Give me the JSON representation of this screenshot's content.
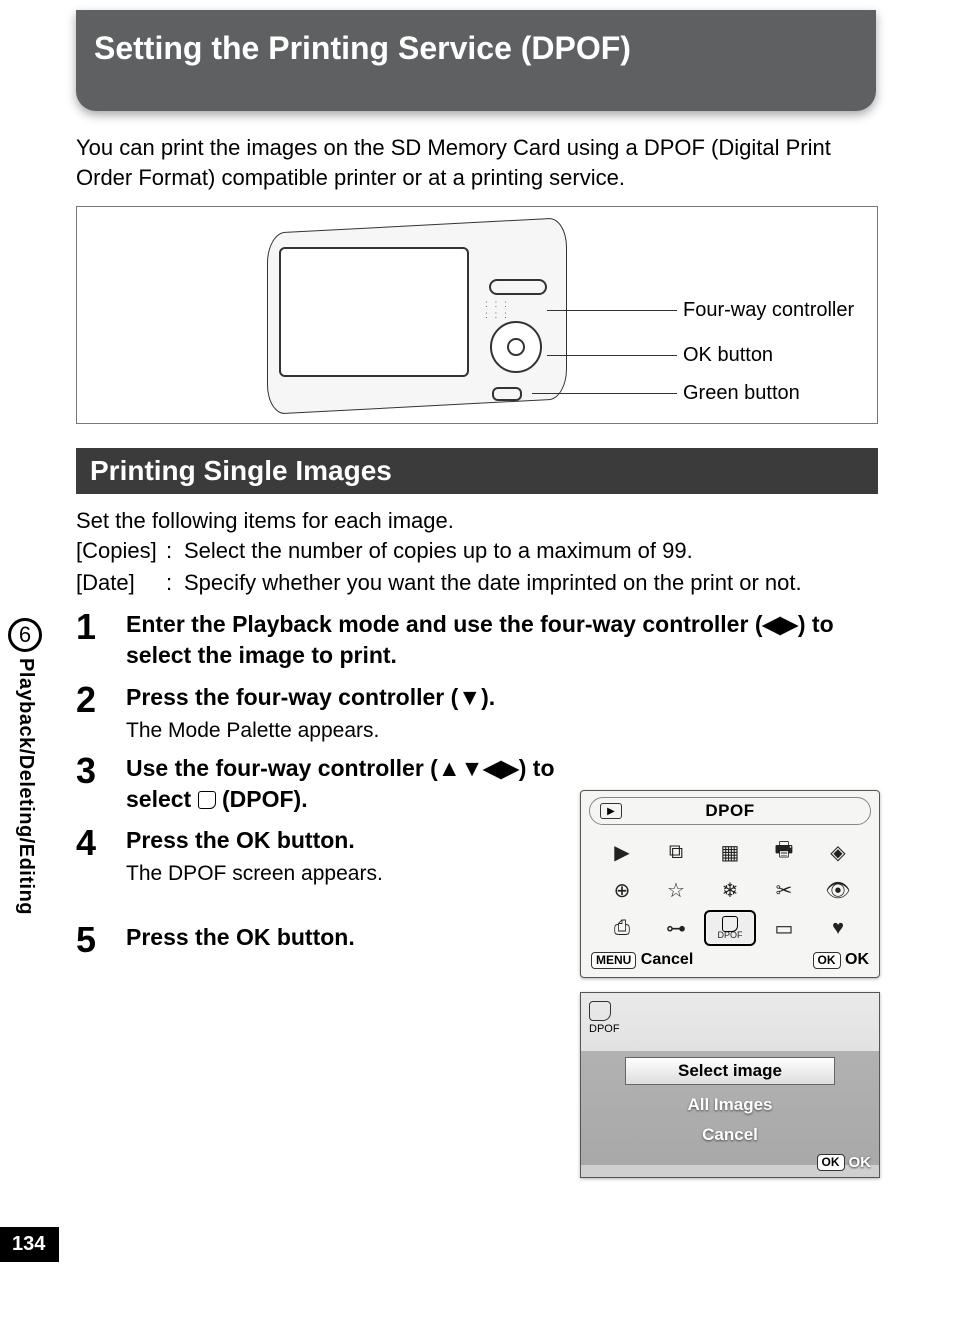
{
  "page_number": "134",
  "chapter_number": "6",
  "side_label": "Playback/Deleting/Editing",
  "title": "Setting the Printing Service (DPOF)",
  "intro": "You can print the images on the SD Memory Card using a DPOF (Digital Print Order Format) compatible printer or at a printing service.",
  "camera_labels": {
    "four_way": "Four-way controller",
    "ok": "OK button",
    "green": "Green button"
  },
  "section_heading": "Printing Single Images",
  "section_intro": "Set the following items for each image.",
  "definitions": [
    {
      "key": "[Copies]",
      "colon": ":",
      "text": "Select the number of copies up to a maximum of 99."
    },
    {
      "key": "[Date]",
      "colon": ":",
      "text": "Specify whether you want the date imprinted on the print or not."
    }
  ],
  "steps": [
    {
      "n": "1",
      "title_a": "Enter the Playback mode and use the four-way controller (",
      "arrows_a": "◀▶",
      "title_b": ") to select the image to print."
    },
    {
      "n": "2",
      "title_a": "Press the four-way controller (",
      "arrows_a": "▼",
      "title_b": ").",
      "sub": "The Mode Palette appears."
    },
    {
      "n": "3",
      "title_a": "Use the four-way controller (",
      "arrows_a": "▲▼◀▶",
      "title_b": ") to select ",
      "title_c": " (DPOF)."
    },
    {
      "n": "4",
      "title_a": "Press the OK button.",
      "sub": "The DPOF screen appears."
    },
    {
      "n": "5",
      "title_a": "Press the OK button."
    }
  ],
  "lcd1": {
    "title": "DPOF",
    "selected_label": "DPOF",
    "footer_left_btn": "MENU",
    "footer_left": "Cancel",
    "footer_right_btn": "OK",
    "footer_right": "OK"
  },
  "lcd2": {
    "corner_label": "DPOF",
    "items": [
      "Select image",
      "All Images",
      "Cancel"
    ],
    "footer_btn": "OK",
    "footer": "OK"
  }
}
